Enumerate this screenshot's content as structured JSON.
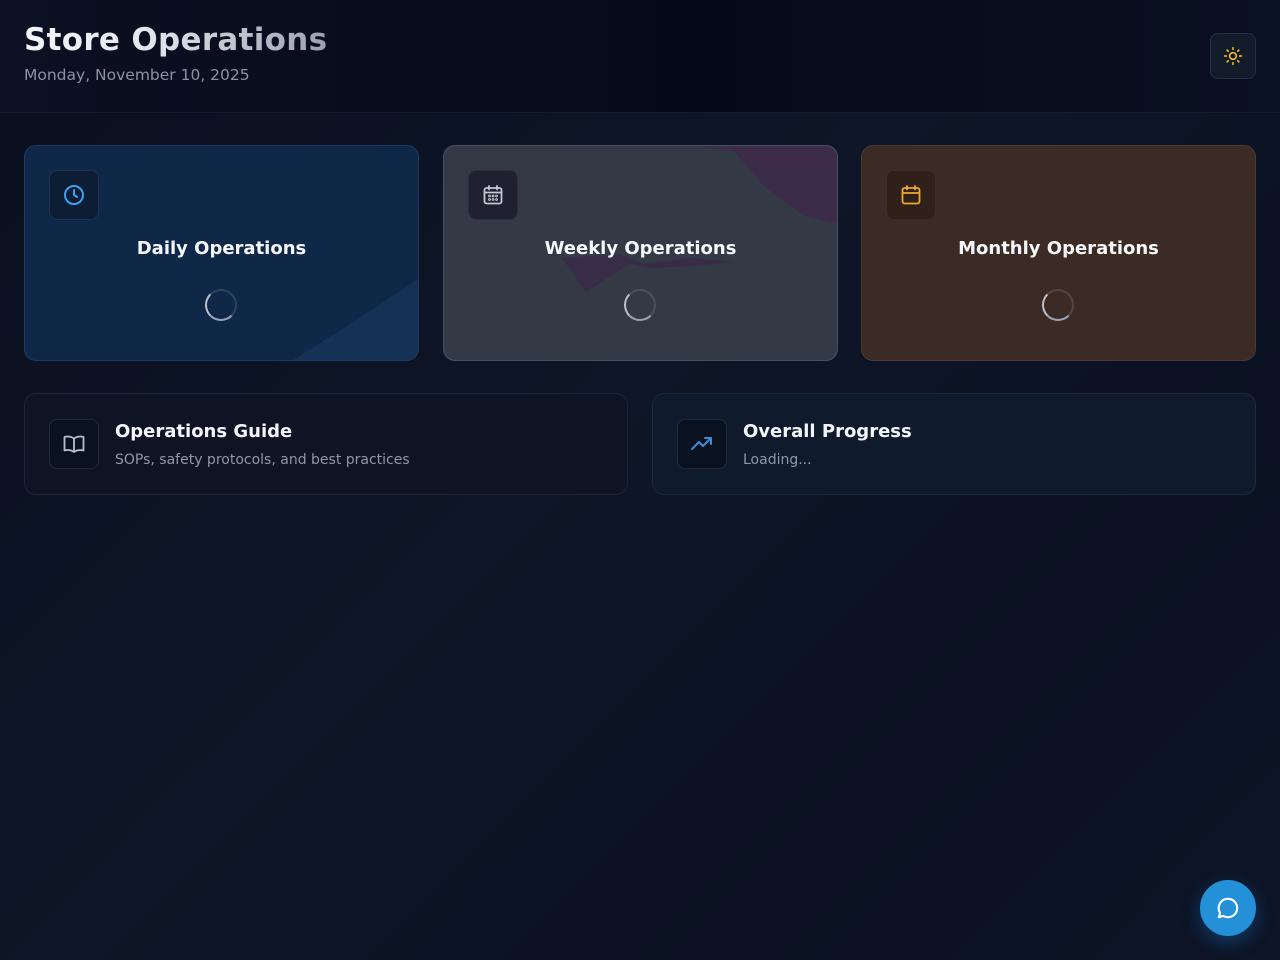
{
  "header": {
    "title": "Store Operations",
    "date": "Monday, November 10, 2025",
    "theme_toggle_icon": "sun-icon"
  },
  "cards": [
    {
      "title": "Daily Operations",
      "icon": "clock-icon",
      "accent": "#3aa0f0"
    },
    {
      "title": "Weekly Operations",
      "icon": "calendar-grid-icon",
      "accent": "#c3c8d2"
    },
    {
      "title": "Monthly Operations",
      "icon": "calendar-icon",
      "accent": "#f0a82a"
    }
  ],
  "guide": {
    "title": "Operations Guide",
    "subtitle": "SOPs, safety protocols, and best practices",
    "icon": "book-open-icon"
  },
  "progress": {
    "title": "Overall Progress",
    "status": "Loading...",
    "icon": "trending-up-icon",
    "accent": "#3a8ed6"
  },
  "chat": {
    "icon": "chat-bubble-icon",
    "color": "#2490d8"
  }
}
